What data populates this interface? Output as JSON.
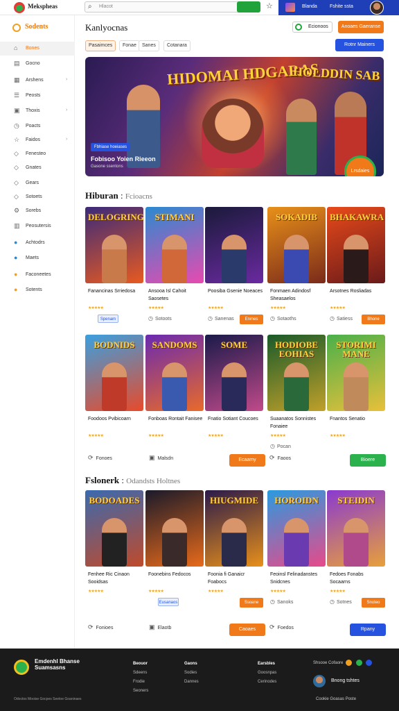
{
  "header": {
    "brand": "Mekspheas",
    "search_placeholder": "Hlacot",
    "search_button": "",
    "user_lang": "Blanda",
    "user_links": "Fshite ssta"
  },
  "sidebar": {
    "title": "Sodents",
    "items": [
      {
        "label": "Bones",
        "icon": "home-icon",
        "active": true,
        "arrow": false
      },
      {
        "label": "Gocno",
        "icon": "book-icon",
        "active": false,
        "arrow": false
      },
      {
        "label": "Arshens",
        "icon": "grid-icon",
        "active": false,
        "arrow": true
      },
      {
        "label": "Peosts",
        "icon": "list-icon",
        "active": false,
        "arrow": false
      },
      {
        "label": "Thoxis",
        "icon": "image-icon",
        "active": false,
        "arrow": true
      },
      {
        "label": "Poacts",
        "icon": "clock-icon",
        "active": false,
        "arrow": false
      },
      {
        "label": "Faidos",
        "icon": "star-icon",
        "active": false,
        "arrow": true
      },
      {
        "label": "Fenesteo",
        "icon": "tag-icon",
        "active": false,
        "arrow": false
      },
      {
        "label": "Gnates",
        "icon": "tag-icon",
        "active": false,
        "arrow": false
      },
      {
        "label": "Gears",
        "icon": "tag-icon",
        "active": false,
        "arrow": false
      },
      {
        "label": "Sotoets",
        "icon": "tag-icon",
        "active": false,
        "arrow": false
      },
      {
        "label": "Sorebs",
        "icon": "gear-icon",
        "active": false,
        "arrow": false
      },
      {
        "label": "Peosutersis",
        "icon": "calendar-icon",
        "active": false,
        "arrow": false
      },
      {
        "label": "Achtodrs",
        "icon": "blue-dot-icon",
        "active": false,
        "arrow": false
      },
      {
        "label": "Maets",
        "icon": "blue-dot-icon",
        "active": false,
        "arrow": false
      },
      {
        "label": "Faconeetes",
        "icon": "orange-dot-icon",
        "active": false,
        "arrow": false
      },
      {
        "label": "Sotents",
        "icon": "orange-dot-icon",
        "active": false,
        "arrow": false
      }
    ]
  },
  "page": {
    "title": "Kanlyocnas",
    "subscribe_label": "Ecionoos",
    "primary_action": "Anoaes Gaeranse",
    "chips": [
      "Pasaimces",
      "Fonae",
      "Sanes",
      "Cotanara"
    ],
    "blue_action": "Rotnr Mainers"
  },
  "banner": {
    "title_left": "HIDOMAI HDGARAS",
    "title_right": "HOLDDIN SAB",
    "tag": "Fbhiase hoeiases",
    "caption": "Fobisoo Yoien Rieeon",
    "subcaption": "Gasone ssentons",
    "badge": "Lrsdaies"
  },
  "section1": {
    "title": "Hiburan",
    "subtitle": "Fcioacns",
    "cards": [
      {
        "art_title": "DELOGRING",
        "name": "Fanancinas Srriedosa",
        "mini": "",
        "pill": "Spenam",
        "button": "",
        "colors": [
          "#3b2a7a",
          "#e85a20"
        ],
        "fig": "#c97a4a"
      },
      {
        "art_title": "STIMANI",
        "name": "Ansooa Isl Cahoit Saosetes",
        "mini": "Sotoots",
        "pill": "",
        "button": "",
        "colors": [
          "#2a8ad0",
          "#e84ab0"
        ],
        "fig": "#d0683a"
      },
      {
        "art_title": "",
        "name": "Poosiba Gsenie Noeaces",
        "mini": "Sanenas",
        "pill": "",
        "button": "Enmes",
        "colors": [
          "#1a1a3a",
          "#6a2aa0"
        ],
        "fig": "#2a3a6a"
      },
      {
        "art_title": "SOKADIB",
        "name": "Fonmaen Adindosf Sheasaelos",
        "mini": "Sotaoths",
        "pill": "",
        "button": "",
        "colors": [
          "#e8901a",
          "#7a2a1a"
        ],
        "fig": "#3a4ab0"
      },
      {
        "art_title": "BHAKAWRA",
        "name": "Arsotnes Rosliadas",
        "mini": "Satiess",
        "pill": "",
        "button": "Bhone",
        "colors": [
          "#e84a1a",
          "#6a1a1a"
        ],
        "fig": "#2a1a1a"
      }
    ]
  },
  "section1_row2": {
    "cards": [
      {
        "art_title": "BODNIDS",
        "name": "Foodoos Pvibicoarn",
        "mini": "",
        "pill": "",
        "button": "",
        "colors": [
          "#3aa0e0",
          "#e84a2a"
        ],
        "fig": "#c03a2a"
      },
      {
        "art_title": "SANDOMS",
        "name": "Fonboas Rontait Fanisee",
        "mini": "",
        "pill": "",
        "button": "",
        "colors": [
          "#6a2ab0",
          "#e86a2a"
        ],
        "fig": "#3a5ab0"
      },
      {
        "art_title": "SOME",
        "name": "Fnatio Sotiant Coucoes",
        "mini": "",
        "pill": "",
        "button": "",
        "colors": [
          "#1a1a4a",
          "#c04a8a"
        ],
        "fig": "#2a2a5a"
      },
      {
        "art_title": "HODIOBE EOHIAS",
        "name": "Suaanatos Sonnistes Fonaiee",
        "mini": "Pocan",
        "pill": "",
        "button": "",
        "colors": [
          "#1a5a2a",
          "#c0a02a"
        ],
        "fig": "#2a6a3a"
      },
      {
        "art_title": "STORIMI MANE",
        "name": "Fnantos Senatio",
        "mini": "",
        "pill": "",
        "button": "",
        "colors": [
          "#4ab04a",
          "#e8c03a"
        ],
        "fig": "#c08a5a"
      }
    ],
    "footer": [
      {
        "label": "Fonoes",
        "button": "",
        "icon": "refresh-icon"
      },
      {
        "label": "Malsdn",
        "button": "Ecaamy",
        "icon": "image-icon"
      },
      {
        "label": "Faoos",
        "button": "Bioere",
        "icon": "refresh-icon"
      }
    ]
  },
  "section2": {
    "title": "Fslonerk",
    "subtitle": "Odandsts Holtnes",
    "cards": [
      {
        "art_title": "BODOADES",
        "name": "Fenhee Ric Cinaon Sooidsas",
        "mini": "",
        "pill": "",
        "button": "",
        "colors": [
          "#3a6ab0",
          "#c04a2a"
        ],
        "fig": "#222"
      },
      {
        "art_title": "",
        "name": "Foonebins Fedocos",
        "mini": "",
        "pill": "Eusanaos",
        "button": "",
        "colors": [
          "#1a1a2a",
          "#e86a1a"
        ],
        "fig": "#3a2a2a"
      },
      {
        "art_title": "HIUGMIDE",
        "name": "Foonia fi Ganaicr Foabocs",
        "mini": "",
        "pill": "",
        "button": "Ssoane",
        "colors": [
          "#2a1a4a",
          "#e8901a"
        ],
        "fig": "#2a2a4a"
      },
      {
        "art_title": "HOROIDN",
        "name": "Feoinsl Felinadanstes Snidcnes",
        "mini": "Sanoks",
        "pill": "",
        "button": "",
        "colors": [
          "#2a9ae0",
          "#e84a8a"
        ],
        "fig": "#6a3ab0"
      },
      {
        "art_title": "STEIDIN",
        "name": "Fedoes Fonabs Socaarns",
        "mini": "Sotnes",
        "pill": "",
        "button": "Snoteo",
        "colors": [
          "#8a3ad0",
          "#e8a03a"
        ],
        "fig": "#b04a8a"
      }
    ],
    "footer": [
      {
        "label": "Fonioes",
        "button": "",
        "icon": "refresh-icon"
      },
      {
        "label": "Elaotb",
        "button": "Caoaes",
        "icon": "image-icon"
      },
      {
        "label": "Foedos",
        "button": "Rpany",
        "icon": "refresh-icon"
      }
    ]
  },
  "footer": {
    "brand": "Emdenhl Bhanse Suamsasns",
    "col1": {
      "title": "Beouor",
      "items": [
        "Sdeens",
        "Frodie",
        "Seoners"
      ]
    },
    "col2": {
      "title": "Gaons",
      "items": [
        "Sodies",
        "Dannes"
      ]
    },
    "col3": {
      "title": "Earsbles",
      "items": [
        "Goosnpas",
        "Cerinodes"
      ]
    },
    "social_label": "Shsooe Cofaore",
    "user_name": "Bnong tshtes",
    "copyright": "Odoctos Mooise Gocpes Seetoe Goaninaes",
    "copyright2": "Cookie Goasas Poste"
  }
}
